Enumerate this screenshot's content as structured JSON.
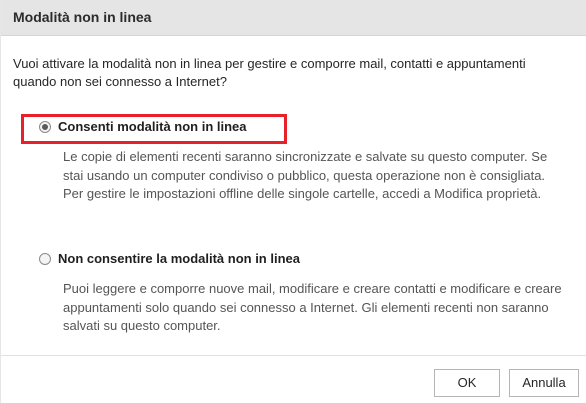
{
  "dialog": {
    "title": "Modalità non in linea",
    "question": "Vuoi attivare la modalità non in linea per gestire e comporre mail, contatti e appuntamenti quando non sei connesso a Internet?",
    "options": [
      {
        "label": "Consenti modalità non in linea",
        "selected": true,
        "description": "Le copie di elementi recenti saranno sincronizzate e salvate su questo computer. Se stai usando un computer condiviso o pubblico, questa operazione non è consigliata. Per gestire le impostazioni offline delle singole cartelle, accedi a Modifica proprietà."
      },
      {
        "label": "Non consentire la modalità non in linea",
        "selected": false,
        "description": "Puoi leggere e comporre nuove mail, modificare e creare contatti e modificare e creare appuntamenti solo quando sei connesso a Internet. Gli elementi recenti non saranno salvati su questo computer."
      }
    ],
    "buttons": {
      "ok": "OK",
      "cancel": "Annulla"
    },
    "highlight_color": "#e8202a"
  }
}
